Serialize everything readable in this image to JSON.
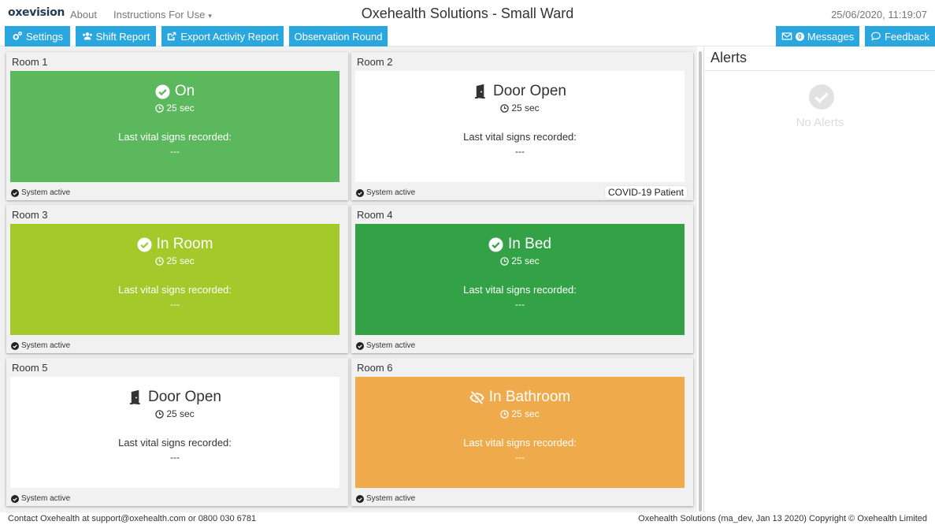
{
  "header": {
    "brand": "oxevision",
    "nav": {
      "about": "About",
      "instructions": "Instructions For Use"
    },
    "title": "Oxehealth Solutions - Small Ward",
    "datetime": "25/06/2020, 11:19:07"
  },
  "toolbar": {
    "settings": "Settings",
    "shift_report": "Shift Report",
    "export_report": "Export Activity Report",
    "observation_round": "Observation Round",
    "messages": "Messages",
    "messages_count": "0",
    "feedback": "Feedback"
  },
  "rooms": [
    {
      "name": "Room 1",
      "status": "On",
      "status_icon": "check-circle-icon",
      "timer": "25 sec",
      "vitals_label": "Last vital signs recorded:",
      "vitals_value": "---",
      "system": "System active",
      "color": "#5cb85c"
    },
    {
      "name": "Room 2",
      "status": "Door Open",
      "status_icon": "door-open-icon",
      "timer": "25 sec",
      "vitals_label": "Last vital signs recorded:",
      "vitals_value": "---",
      "system": "System active",
      "tag": "COVID-19 Patient",
      "color": "#ffffff"
    },
    {
      "name": "Room 3",
      "status": "In Room",
      "status_icon": "check-circle-icon",
      "timer": "25 sec",
      "vitals_label": "Last vital signs recorded:",
      "vitals_value": "---",
      "system": "System active",
      "color": "#a4c92b"
    },
    {
      "name": "Room 4",
      "status": "In Bed",
      "status_icon": "check-circle-icon",
      "timer": "25 sec",
      "vitals_label": "Last vital signs recorded:",
      "vitals_value": "---",
      "system": "System active",
      "color": "#33a145"
    },
    {
      "name": "Room 5",
      "status": "Door Open",
      "status_icon": "door-open-icon",
      "timer": "25 sec",
      "vitals_label": "Last vital signs recorded:",
      "vitals_value": "---",
      "system": "System active",
      "color": "#ffffff"
    },
    {
      "name": "Room 6",
      "status": "In Bathroom",
      "status_icon": "eye-slash-icon",
      "timer": "25 sec",
      "vitals_label": "Last vital signs recorded:",
      "vitals_value": "---",
      "system": "System active",
      "color": "#efaa4b"
    }
  ],
  "alerts": {
    "title": "Alerts",
    "empty_text": "No Alerts"
  },
  "footer": {
    "left": "Contact Oxehealth at support@oxehealth.com or 0800 030 6781",
    "right": "Oxehealth Solutions (ma_dev, Jan 13 2020) Copyright © Oxehealth Limited"
  },
  "colors": {
    "toolbar": "#2aa7df",
    "brand": "#1f3b57"
  }
}
